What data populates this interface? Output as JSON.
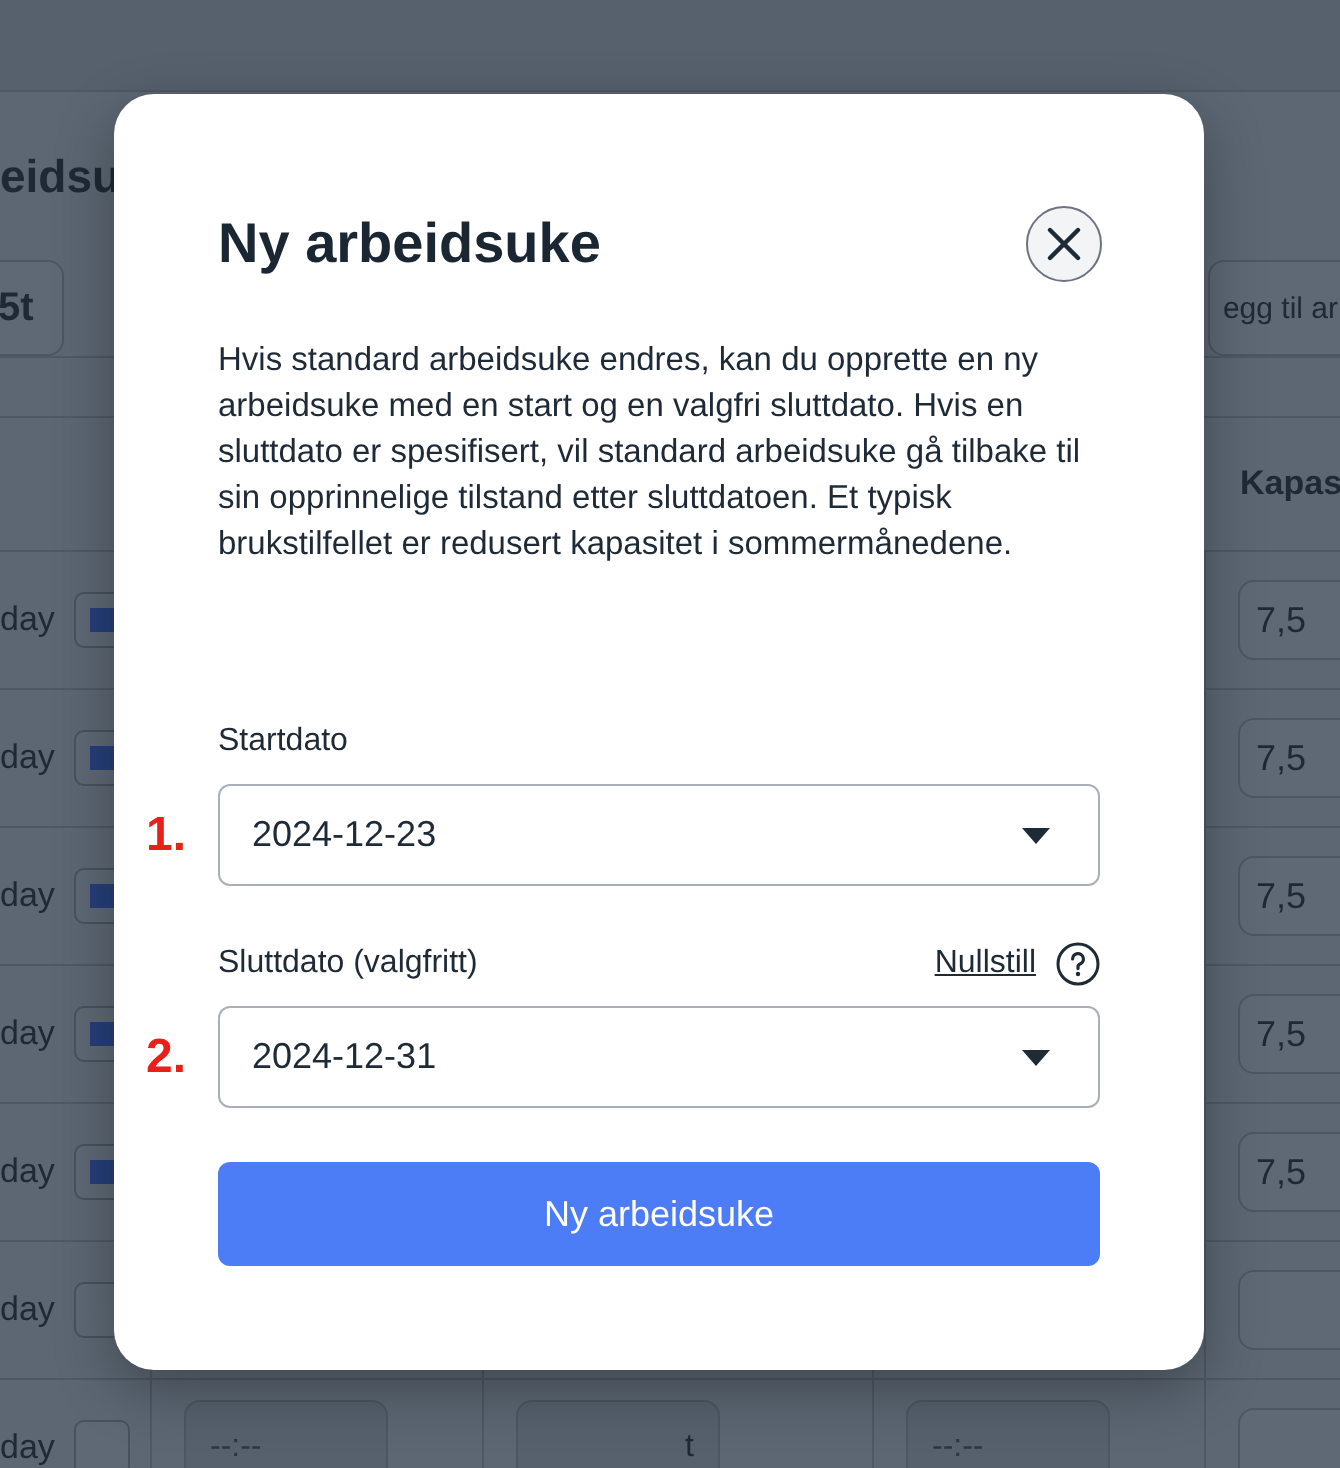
{
  "background": {
    "title": "eidsu",
    "toolbar_button": "5t",
    "add_button": "egg til ar",
    "column_header": "Kapas",
    "rows": [
      {
        "label": "day",
        "checked": true,
        "capacity": "7,5"
      },
      {
        "label": "day",
        "checked": true,
        "capacity": "7,5"
      },
      {
        "label": "day",
        "checked": true,
        "capacity": "7,5"
      },
      {
        "label": "day",
        "checked": true,
        "capacity": "7,5"
      },
      {
        "label": "day",
        "checked": true,
        "capacity": "7,5"
      },
      {
        "label": "day",
        "checked": false
      },
      {
        "label": "day",
        "checked": false,
        "start_placeholder": "--:--",
        "hours": "t",
        "end_placeholder": "--:--"
      }
    ]
  },
  "dialog": {
    "title": "Ny arbeidsuke",
    "description": "Hvis standard arbeidsuke endres, kan du opprette en ny arbeidsuke med en start og en valgfri sluttdato. Hvis en sluttdato er spesifisert, vil standard arbeidsuke gå tilbake til sin opprinnelige tilstand etter sluttdatoen. Et typisk brukstilfellet er redusert kapasitet i sommermånedene.",
    "fields": [
      {
        "label": "Startdato",
        "marker": "1.",
        "value": "2024-12-23"
      },
      {
        "label": "Sluttdato (valgfritt)",
        "reset_link": "Nullstill",
        "help": true,
        "marker": "2.",
        "value": "2024-12-31"
      }
    ],
    "submit_button": "Ny arbeidsuke"
  }
}
